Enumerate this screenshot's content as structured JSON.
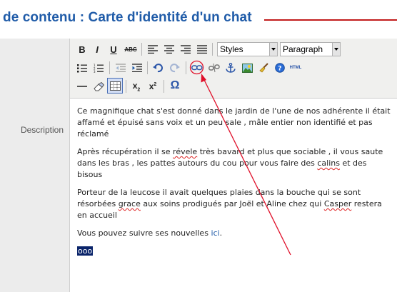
{
  "header": {
    "title": "de contenu : Carte d'identité d'un chat"
  },
  "form": {
    "description_label": "Description"
  },
  "toolbar": {
    "bold_label": "B",
    "italic_label": "I",
    "underline_label": "U",
    "strike_label": "ABC",
    "styles_select": "Styles",
    "format_select": "Paragraph",
    "html_label": "HTML",
    "sub_label": "x",
    "sub_mark": "2",
    "sup_label": "x",
    "sup_mark": "2",
    "omega_label": "Ω"
  },
  "content": {
    "p1": "Ce magnifique chat s'est donné dans le jardin de l'une de nos adhérente il était affamé et épuisé sans voix et un peu sale , mâle entier non identifié et pas réclamé",
    "p2_a": "Après récupération il se ",
    "p2_sq1": "révele",
    "p2_b": " très bavard et plus que sociable , il vous saute dans les bras , les pattes autours du cou pour vous faire des ",
    "p2_sq2": "calins",
    "p2_c": " et des bisous",
    "p3_a": "Porteur de la leucose il avait quelques plaies dans la bouche qui se sont résorbées ",
    "p3_sq1": "grace",
    "p3_b": " aux soins prodigués par Joël et Aline chez qui ",
    "p3_sq2": "Casper",
    "p3_c": " restera en accueil",
    "p4_a": "Vous pouvez suivre ses nouvelles ",
    "p4_link": "ici",
    "p4_b": ".",
    "selected": "ooo"
  },
  "colors": {
    "title": "#1f5ba8",
    "annotation": "#e0102a",
    "selection": "#0a246a"
  }
}
